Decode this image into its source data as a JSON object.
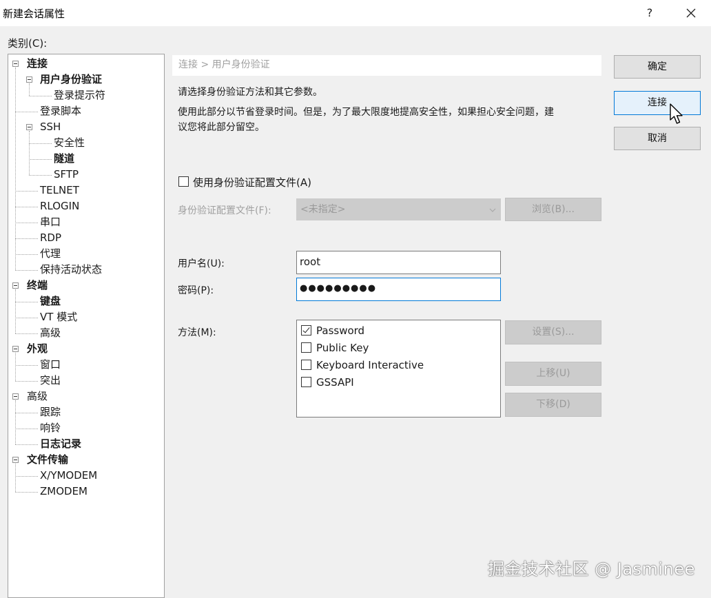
{
  "window": {
    "title": "新建会话属性",
    "help_label": "?",
    "close_icon": "close-icon"
  },
  "category": {
    "label": "类别(C):",
    "tree": [
      {
        "label": "连接",
        "bold": true,
        "level": 0,
        "expander": true
      },
      {
        "label": "用户身份验证",
        "bold": true,
        "level": 1,
        "expander": true,
        "selected": true
      },
      {
        "label": "登录提示符",
        "bold": false,
        "level": 2
      },
      {
        "label": "登录脚本",
        "bold": false,
        "level": 1
      },
      {
        "label": "SSH",
        "bold": false,
        "level": 1,
        "expander": true
      },
      {
        "label": "安全性",
        "bold": false,
        "level": 2
      },
      {
        "label": "隧道",
        "bold": true,
        "level": 2
      },
      {
        "label": "SFTP",
        "bold": false,
        "level": 2
      },
      {
        "label": "TELNET",
        "bold": false,
        "level": 1
      },
      {
        "label": "RLOGIN",
        "bold": false,
        "level": 1
      },
      {
        "label": "串口",
        "bold": false,
        "level": 1
      },
      {
        "label": "RDP",
        "bold": false,
        "level": 1
      },
      {
        "label": "代理",
        "bold": false,
        "level": 1
      },
      {
        "label": "保持活动状态",
        "bold": false,
        "level": 1
      },
      {
        "label": "终端",
        "bold": true,
        "level": 0,
        "expander": true
      },
      {
        "label": "键盘",
        "bold": true,
        "level": 1
      },
      {
        "label": "VT 模式",
        "bold": false,
        "level": 1
      },
      {
        "label": "高级",
        "bold": false,
        "level": 1
      },
      {
        "label": "外观",
        "bold": true,
        "level": 0,
        "expander": true
      },
      {
        "label": "窗口",
        "bold": false,
        "level": 1
      },
      {
        "label": "突出",
        "bold": false,
        "level": 1
      },
      {
        "label": "高级",
        "bold": false,
        "level": 0,
        "expander": true
      },
      {
        "label": "跟踪",
        "bold": false,
        "level": 1
      },
      {
        "label": "响铃",
        "bold": false,
        "level": 1
      },
      {
        "label": "日志记录",
        "bold": true,
        "level": 1
      },
      {
        "label": "文件传输",
        "bold": true,
        "level": 0,
        "expander": true
      },
      {
        "label": "X/YMODEM",
        "bold": false,
        "level": 1
      },
      {
        "label": "ZMODEM",
        "bold": false,
        "level": 1
      }
    ]
  },
  "panel": {
    "breadcrumb": "连接 > 用户身份验证",
    "desc1": "请选择身份验证方法和其它参数。",
    "desc2_line1": "使用此部分以节省登录时间。但是，为了最大限度地提高安全性，如果担心安全问题，建",
    "desc2_line2": "议您将此部分留空。",
    "use_profile_label": "使用身份验证配置文件(A)",
    "use_profile_checked": false,
    "profile_label": "身份验证配置文件(F):",
    "profile_value": "<未指定>",
    "browse_label": "浏览(B)...",
    "username_label": "用户名(U):",
    "username_value": "root",
    "password_label": "密码(P):",
    "password_value": "●●●●●●●●●",
    "method_label": "方法(M):",
    "methods": [
      {
        "label": "Password",
        "checked": true
      },
      {
        "label": "Public Key",
        "checked": false
      },
      {
        "label": "Keyboard Interactive",
        "checked": false
      },
      {
        "label": "GSSAPI",
        "checked": false
      }
    ],
    "settings_label": "设置(S)...",
    "move_up_label": "上移(U)",
    "move_down_label": "下移(D)"
  },
  "buttons": {
    "ok": "确定",
    "connect": "连接",
    "cancel": "取消"
  },
  "watermark": "掘金技术社区 @ Jasminee",
  "colors": {
    "accent": "#0078d7",
    "background": "#f0f0f0",
    "disabled": "#cccccc"
  }
}
